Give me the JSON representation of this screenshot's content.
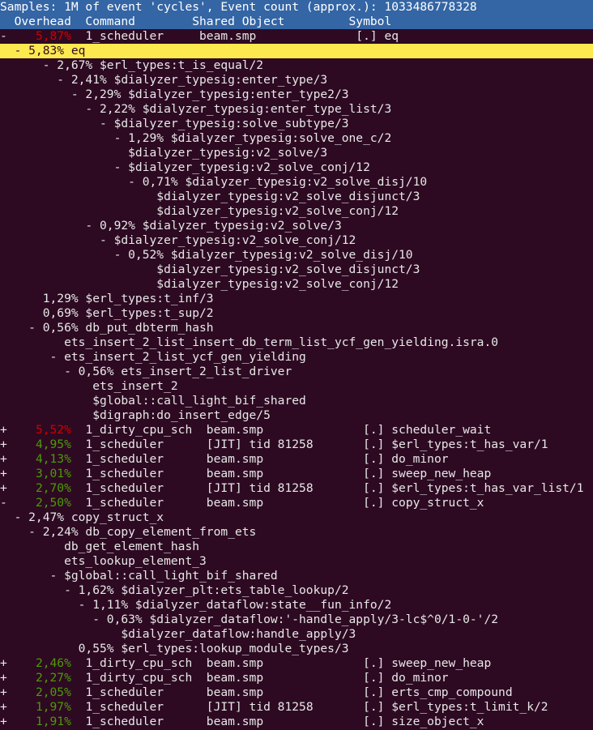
{
  "app": {
    "name": "perf-report-tui",
    "colors": {
      "banner_bg": "#3465a4",
      "banner_fg": "#ffffff",
      "body_bg": "#2d0a22",
      "body_fg": "#e8e8e8",
      "selected_bg": "#fce94f",
      "selected_fg": "#2d0a22",
      "pct_high": "#cc0000",
      "pct_normal": "#4e9a06"
    }
  },
  "banner": {
    "summary": "Samples: 1M of event 'cycles', Event count (approx.): 1033486778328",
    "columns": {
      "overhead": "Overhead",
      "command": "Command",
      "shared_object": "Shared Object",
      "symbol": "Symbol"
    },
    "header_row": "  Overhead  Command        Shared Object         Symbol"
  },
  "rows": [
    {
      "kind": "entry",
      "sign": "-",
      "pct": "5,87%",
      "pct_color": "red",
      "command": "1_scheduler",
      "dso": "beam.smp",
      "symbol": "[.] eq",
      "text": "-    5,87%  1_scheduler     beam.smp              [.] eq"
    },
    {
      "kind": "callchain",
      "selected": true,
      "indent": 2,
      "sign": "-",
      "pct": "5,83%",
      "label": "eq",
      "text": "  - 5,83% eq"
    },
    {
      "kind": "callchain",
      "indent": 6,
      "sign": "-",
      "pct": "2,67%",
      "label": "$erl_types:t_is_equal/2",
      "text": "      - 2,67% $erl_types:t_is_equal/2"
    },
    {
      "kind": "callchain",
      "indent": 8,
      "sign": "-",
      "pct": "2,41%",
      "label": "$dialyzer_typesig:enter_type/3",
      "text": "        - 2,41% $dialyzer_typesig:enter_type/3"
    },
    {
      "kind": "callchain",
      "indent": 10,
      "sign": "-",
      "pct": "2,29%",
      "label": "$dialyzer_typesig:enter_type2/3",
      "text": "          - 2,29% $dialyzer_typesig:enter_type2/3"
    },
    {
      "kind": "callchain",
      "indent": 12,
      "sign": "-",
      "pct": "2,22%",
      "label": "$dialyzer_typesig:enter_type_list/3",
      "text": "            - 2,22% $dialyzer_typesig:enter_type_list/3"
    },
    {
      "kind": "callchain",
      "indent": 14,
      "sign": "-",
      "pct": "",
      "label": "$dialyzer_typesig:solve_subtype/3",
      "text": "              - $dialyzer_typesig:solve_subtype/3"
    },
    {
      "kind": "callchain",
      "indent": 16,
      "sign": "-",
      "pct": "1,29%",
      "label": "$dialyzer_typesig:solve_one_c/2",
      "text": "                - 1,29% $dialyzer_typesig:solve_one_c/2"
    },
    {
      "kind": "callchain",
      "indent": 18,
      "sign": "",
      "pct": "",
      "label": "$dialyzer_typesig:v2_solve/3",
      "text": "                  $dialyzer_typesig:v2_solve/3"
    },
    {
      "kind": "callchain",
      "indent": 16,
      "sign": "-",
      "pct": "",
      "label": "$dialyzer_typesig:v2_solve_conj/12",
      "text": "                - $dialyzer_typesig:v2_solve_conj/12"
    },
    {
      "kind": "callchain",
      "indent": 18,
      "sign": "-",
      "pct": "0,71%",
      "label": "$dialyzer_typesig:v2_solve_disj/10",
      "text": "                  - 0,71% $dialyzer_typesig:v2_solve_disj/10"
    },
    {
      "kind": "callchain",
      "indent": 22,
      "sign": "",
      "pct": "",
      "label": "$dialyzer_typesig:v2_solve_disjunct/3",
      "text": "                      $dialyzer_typesig:v2_solve_disjunct/3"
    },
    {
      "kind": "callchain",
      "indent": 22,
      "sign": "",
      "pct": "",
      "label": "$dialyzer_typesig:v2_solve_conj/12",
      "text": "                      $dialyzer_typesig:v2_solve_conj/12"
    },
    {
      "kind": "callchain",
      "indent": 12,
      "sign": "-",
      "pct": "0,92%",
      "label": "$dialyzer_typesig:v2_solve/3",
      "text": "            - 0,92% $dialyzer_typesig:v2_solve/3"
    },
    {
      "kind": "callchain",
      "indent": 14,
      "sign": "-",
      "pct": "",
      "label": "$dialyzer_typesig:v2_solve_conj/12",
      "text": "              - $dialyzer_typesig:v2_solve_conj/12"
    },
    {
      "kind": "callchain",
      "indent": 16,
      "sign": "-",
      "pct": "0,52%",
      "label": "$dialyzer_typesig:v2_solve_disj/10",
      "text": "                - 0,52% $dialyzer_typesig:v2_solve_disj/10"
    },
    {
      "kind": "callchain",
      "indent": 22,
      "sign": "",
      "pct": "",
      "label": "$dialyzer_typesig:v2_solve_disjunct/3",
      "text": "                      $dialyzer_typesig:v2_solve_disjunct/3"
    },
    {
      "kind": "callchain",
      "indent": 22,
      "sign": "",
      "pct": "",
      "label": "$dialyzer_typesig:v2_solve_conj/12",
      "text": "                      $dialyzer_typesig:v2_solve_conj/12"
    },
    {
      "kind": "callchain",
      "indent": 6,
      "sign": "",
      "pct": "1,29%",
      "label": "$erl_types:t_inf/3",
      "text": "      1,29% $erl_types:t_inf/3"
    },
    {
      "kind": "callchain",
      "indent": 6,
      "sign": "",
      "pct": "0,69%",
      "label": "$erl_types:t_sup/2",
      "text": "      0,69% $erl_types:t_sup/2"
    },
    {
      "kind": "callchain",
      "indent": 4,
      "sign": "-",
      "pct": "0,56%",
      "label": "db_put_dbterm_hash",
      "text": "    - 0,56% db_put_dbterm_hash"
    },
    {
      "kind": "callchain",
      "indent": 9,
      "sign": "",
      "pct": "",
      "label": "ets_insert_2_list_insert_db_term_list_ycf_gen_yielding.isra.0",
      "text": "         ets_insert_2_list_insert_db_term_list_ycf_gen_yielding.isra.0"
    },
    {
      "kind": "callchain",
      "indent": 7,
      "sign": "-",
      "pct": "",
      "label": "ets_insert_2_list_ycf_gen_yielding",
      "text": "       - ets_insert_2_list_ycf_gen_yielding"
    },
    {
      "kind": "callchain",
      "indent": 9,
      "sign": "-",
      "pct": "0,56%",
      "label": "ets_insert_2_list_driver",
      "text": "         - 0,56% ets_insert_2_list_driver"
    },
    {
      "kind": "callchain",
      "indent": 13,
      "sign": "",
      "pct": "",
      "label": "ets_insert_2",
      "text": "             ets_insert_2"
    },
    {
      "kind": "callchain",
      "indent": 13,
      "sign": "",
      "pct": "",
      "label": "$global::call_light_bif_shared",
      "text": "             $global::call_light_bif_shared"
    },
    {
      "kind": "callchain",
      "indent": 13,
      "sign": "",
      "pct": "",
      "label": "$digraph:do_insert_edge/5",
      "text": "             $digraph:do_insert_edge/5"
    },
    {
      "kind": "entry",
      "sign": "+",
      "pct": "5,52%",
      "pct_color": "red",
      "command": "1_dirty_cpu_sch",
      "dso": "beam.smp",
      "symbol": "[.] scheduler_wait",
      "text": "+    5,52%  1_dirty_cpu_sch  beam.smp              [.] scheduler_wait"
    },
    {
      "kind": "entry",
      "sign": "+",
      "pct": "4,95%",
      "pct_color": "green",
      "command": "1_scheduler",
      "dso": "[JIT] tid 81258",
      "symbol": "[.] $erl_types:t_has_var/1",
      "text": "+    4,95%  1_scheduler      [JIT] tid 81258       [.] $erl_types:t_has_var/1"
    },
    {
      "kind": "entry",
      "sign": "+",
      "pct": "4,13%",
      "pct_color": "green",
      "command": "1_scheduler",
      "dso": "beam.smp",
      "symbol": "[.] do_minor",
      "text": "+    4,13%  1_scheduler      beam.smp              [.] do_minor"
    },
    {
      "kind": "entry",
      "sign": "+",
      "pct": "3,01%",
      "pct_color": "green",
      "command": "1_scheduler",
      "dso": "beam.smp",
      "symbol": "[.] sweep_new_heap",
      "text": "+    3,01%  1_scheduler      beam.smp              [.] sweep_new_heap"
    },
    {
      "kind": "entry",
      "sign": "+",
      "pct": "2,70%",
      "pct_color": "green",
      "command": "1_scheduler",
      "dso": "[JIT] tid 81258",
      "symbol": "[.] $erl_types:t_has_var_list/1",
      "text": "+    2,70%  1_scheduler      [JIT] tid 81258       [.] $erl_types:t_has_var_list/1"
    },
    {
      "kind": "entry",
      "sign": "-",
      "pct": "2,50%",
      "pct_color": "green",
      "command": "1_scheduler",
      "dso": "beam.smp",
      "symbol": "[.] copy_struct_x",
      "text": "-    2,50%  1_scheduler      beam.smp              [.] copy_struct_x"
    },
    {
      "kind": "callchain",
      "indent": 2,
      "sign": "-",
      "pct": "2,47%",
      "label": "copy_struct_x",
      "text": "  - 2,47% copy_struct_x"
    },
    {
      "kind": "callchain",
      "indent": 4,
      "sign": "-",
      "pct": "2,24%",
      "label": "db_copy_element_from_ets",
      "text": "    - 2,24% db_copy_element_from_ets"
    },
    {
      "kind": "callchain",
      "indent": 9,
      "sign": "",
      "pct": "",
      "label": "db_get_element_hash",
      "text": "         db_get_element_hash"
    },
    {
      "kind": "callchain",
      "indent": 9,
      "sign": "",
      "pct": "",
      "label": "ets_lookup_element_3",
      "text": "         ets_lookup_element_3"
    },
    {
      "kind": "callchain",
      "indent": 7,
      "sign": "-",
      "pct": "",
      "label": "$global::call_light_bif_shared",
      "text": "       - $global::call_light_bif_shared"
    },
    {
      "kind": "callchain",
      "indent": 9,
      "sign": "-",
      "pct": "1,62%",
      "label": "$dialyzer_plt:ets_table_lookup/2",
      "text": "         - 1,62% $dialyzer_plt:ets_table_lookup/2"
    },
    {
      "kind": "callchain",
      "indent": 11,
      "sign": "-",
      "pct": "1,11%",
      "label": "$dialyzer_dataflow:state__fun_info/2",
      "text": "           - 1,11% $dialyzer_dataflow:state__fun_info/2"
    },
    {
      "kind": "callchain",
      "indent": 13,
      "sign": "-",
      "pct": "0,63%",
      "label": "$dialyzer_dataflow:'-handle_apply/3-lc$^0/1-0-'/2",
      "text": "             - 0,63% $dialyzer_dataflow:'-handle_apply/3-lc$^0/1-0-'/2"
    },
    {
      "kind": "callchain",
      "indent": 17,
      "sign": "",
      "pct": "",
      "label": "$dialyzer_dataflow:handle_apply/3",
      "text": "                 $dialyzer_dataflow:handle_apply/3"
    },
    {
      "kind": "callchain",
      "indent": 11,
      "sign": "",
      "pct": "0,55%",
      "label": "$erl_types:lookup_module_types/3",
      "text": "           0,55% $erl_types:lookup_module_types/3"
    },
    {
      "kind": "entry",
      "sign": "+",
      "pct": "2,46%",
      "pct_color": "green",
      "command": "1_dirty_cpu_sch",
      "dso": "beam.smp",
      "symbol": "[.] sweep_new_heap",
      "text": "+    2,46%  1_dirty_cpu_sch  beam.smp              [.] sweep_new_heap"
    },
    {
      "kind": "entry",
      "sign": "+",
      "pct": "2,27%",
      "pct_color": "green",
      "command": "1_dirty_cpu_sch",
      "dso": "beam.smp",
      "symbol": "[.] do_minor",
      "text": "+    2,27%  1_dirty_cpu_sch  beam.smp              [.] do_minor"
    },
    {
      "kind": "entry",
      "sign": "+",
      "pct": "2,05%",
      "pct_color": "green",
      "command": "1_scheduler",
      "dso": "beam.smp",
      "symbol": "[.] erts_cmp_compound",
      "text": "+    2,05%  1_scheduler      beam.smp              [.] erts_cmp_compound"
    },
    {
      "kind": "entry",
      "sign": "+",
      "pct": "1,97%",
      "pct_color": "green",
      "command": "1_scheduler",
      "dso": "[JIT] tid 81258",
      "symbol": "[.] $erl_types:t_limit_k/2",
      "text": "+    1,97%  1_scheduler      [JIT] tid 81258       [.] $erl_types:t_limit_k/2"
    },
    {
      "kind": "entry",
      "sign": "+",
      "pct": "1,91%",
      "pct_color": "green",
      "command": "1_scheduler",
      "dso": "beam.smp",
      "symbol": "[.] size_object_x",
      "text": "+    1,91%  1_scheduler      beam.smp              [.] size_object_x"
    }
  ]
}
